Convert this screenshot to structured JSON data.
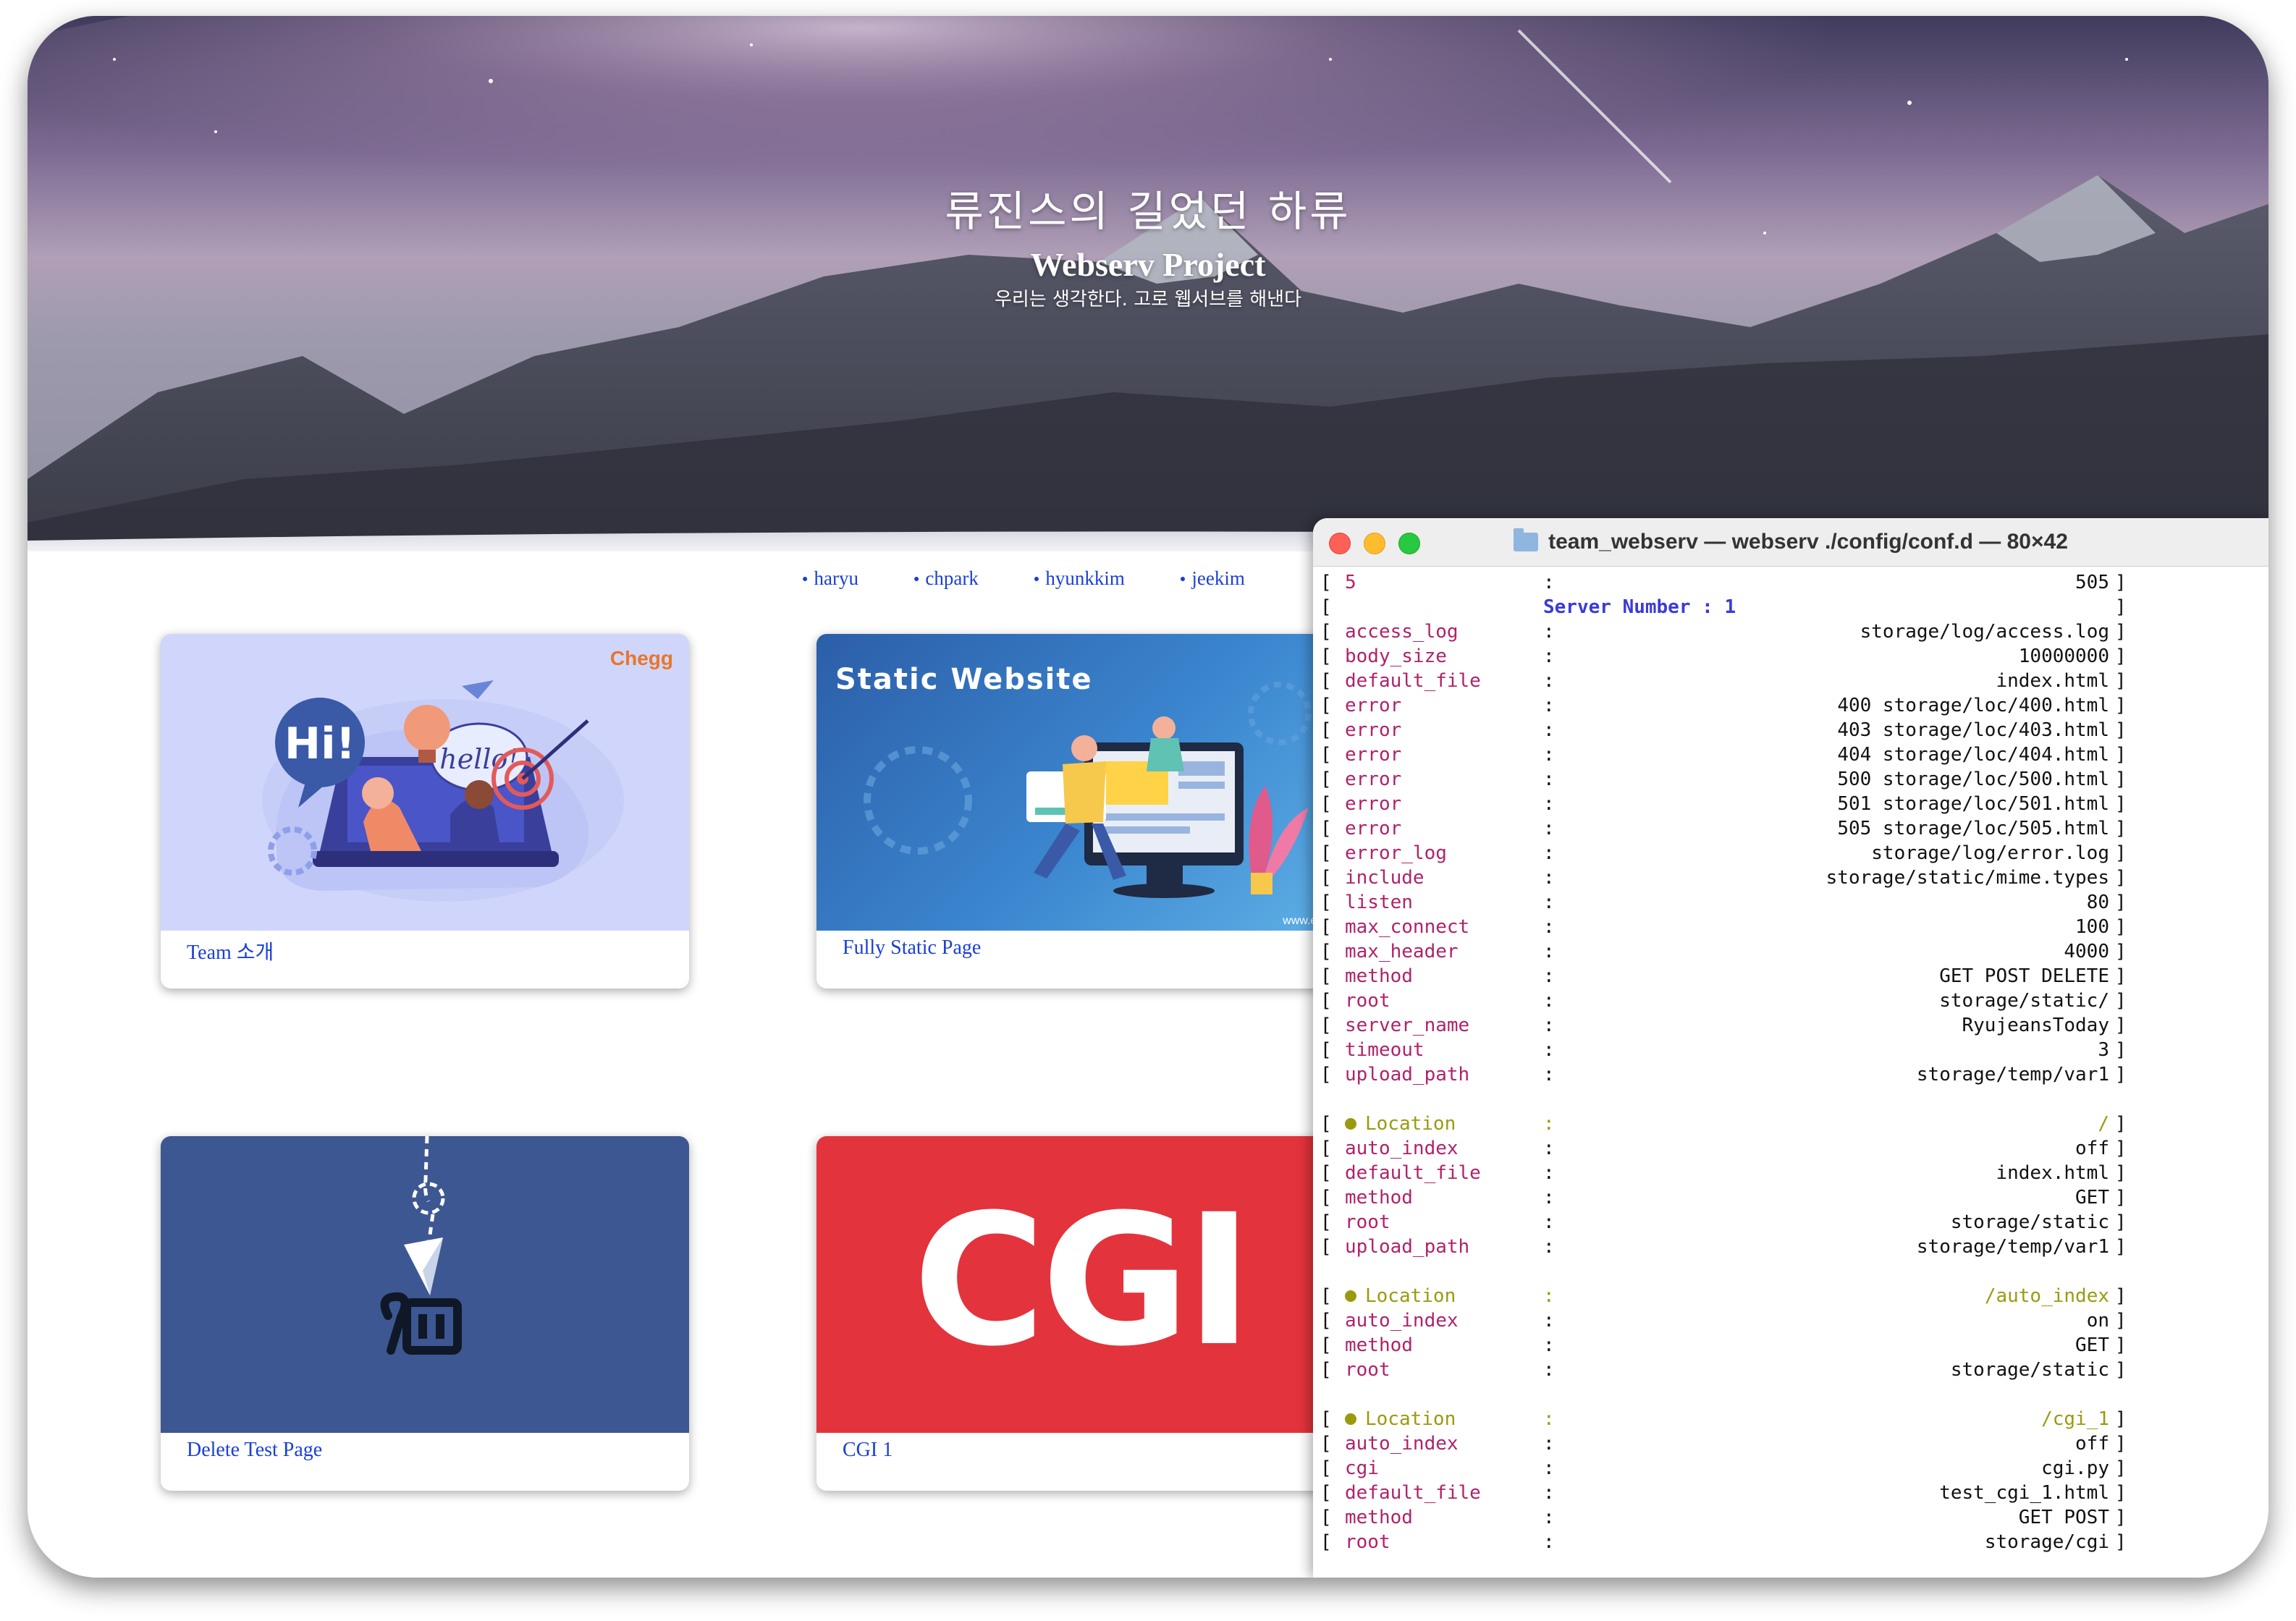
{
  "hero": {
    "korean_title": "류진스의 길었던 하류",
    "title": "Webserv Project",
    "subtitle": "우리는 생각한다. 고로 웹서브를 해낸다"
  },
  "nav": [
    "haryu",
    "chpark",
    "hyunkkim",
    "jeekim"
  ],
  "cards": [
    {
      "caption": "Team 소개",
      "logo": "Chegg",
      "bubble1": "Hi!",
      "bubble2": "hello!"
    },
    {
      "caption": "Fully Static Page",
      "banner": "Static Website",
      "watermark": "www.educb"
    },
    {
      "caption": "Delete Test Page"
    },
    {
      "caption": "CGI 1",
      "logo": "CGI"
    }
  ],
  "terminal": {
    "title": "team_webserv — webserv ./config/conf.d — 80×42",
    "colors": {
      "key": "#b0226a",
      "location": "#9a9a10",
      "server": "#3b3bd6"
    },
    "lines": [
      {
        "key": "5",
        "value": "505"
      },
      {
        "mid": "Server Number : 1"
      },
      {
        "key": "access_log",
        "value": "storage/log/access.log"
      },
      {
        "key": "body_size",
        "value": "10000000"
      },
      {
        "key": "default_file",
        "value": "index.html"
      },
      {
        "key": "error",
        "value": "400 storage/loc/400.html"
      },
      {
        "key": "error",
        "value": "403 storage/loc/403.html"
      },
      {
        "key": "error",
        "value": "404 storage/loc/404.html"
      },
      {
        "key": "error",
        "value": "500 storage/loc/500.html"
      },
      {
        "key": "error",
        "value": "501 storage/loc/501.html"
      },
      {
        "key": "error",
        "value": "505 storage/loc/505.html"
      },
      {
        "key": "error_log",
        "value": "storage/log/error.log"
      },
      {
        "key": "include",
        "value": "storage/static/mime.types"
      },
      {
        "key": "listen",
        "value": "80"
      },
      {
        "key": "max_connect",
        "value": "100"
      },
      {
        "key": "max_header",
        "value": "4000"
      },
      {
        "key": "method",
        "value": "GET POST DELETE"
      },
      {
        "key": "root",
        "value": "storage/static/"
      },
      {
        "key": "server_name",
        "value": "RyujeansToday"
      },
      {
        "key": "timeout",
        "value": "3"
      },
      {
        "key": "upload_path",
        "value": "storage/temp/var1"
      },
      {
        "blank": true
      },
      {
        "loc": true,
        "key": "Location",
        "value": "/"
      },
      {
        "key": "auto_index",
        "value": "off"
      },
      {
        "key": "default_file",
        "value": "index.html"
      },
      {
        "key": "method",
        "value": "GET"
      },
      {
        "key": "root",
        "value": "storage/static"
      },
      {
        "key": "upload_path",
        "value": "storage/temp/var1"
      },
      {
        "blank": true
      },
      {
        "loc": true,
        "key": "Location",
        "value": "/auto_index"
      },
      {
        "key": "auto_index",
        "value": "on"
      },
      {
        "key": "method",
        "value": "GET"
      },
      {
        "key": "root",
        "value": "storage/static"
      },
      {
        "blank": true
      },
      {
        "loc": true,
        "key": "Location",
        "value": "/cgi_1"
      },
      {
        "key": "auto_index",
        "value": "off"
      },
      {
        "key": "cgi",
        "value": "cgi.py"
      },
      {
        "key": "default_file",
        "value": "test_cgi_1.html"
      },
      {
        "key": "method",
        "value": "GET POST"
      },
      {
        "key": "root",
        "value": "storage/cgi"
      }
    ]
  }
}
